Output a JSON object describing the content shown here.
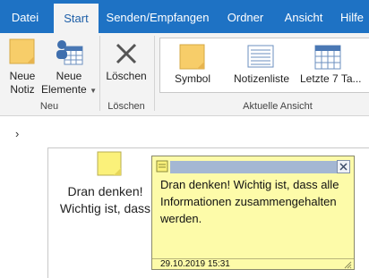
{
  "tabs": [
    {
      "label": "Datei"
    },
    {
      "label": "Start"
    },
    {
      "label": "Senden/Empfangen"
    },
    {
      "label": "Ordner"
    },
    {
      "label": "Ansicht"
    },
    {
      "label": "Hilfe"
    }
  ],
  "ribbon": {
    "new_group": {
      "new_note": [
        "Neue",
        "Notiz"
      ],
      "new_items": [
        "Neue",
        "Elemente"
      ],
      "label": "Neu"
    },
    "delete_group": {
      "delete": "Löschen",
      "label": "Löschen"
    },
    "view_group": {
      "items": [
        "Symbol",
        "Notizenliste",
        "Letzte 7 Ta..."
      ],
      "label": "Aktuelle Ansicht"
    }
  },
  "content": {
    "note_caption": [
      "Dran denken!",
      "Wichtig ist, dass"
    ]
  },
  "note_window": {
    "text": "Dran denken! Wichtig ist, dass alle Informationen zusammengehalten werden.",
    "date": "29.10.2019 15:31"
  },
  "colors": {
    "accent": "#1e72c4",
    "note_yellow": "#fdfba9",
    "note_titlebar": "#a4b7d3"
  }
}
